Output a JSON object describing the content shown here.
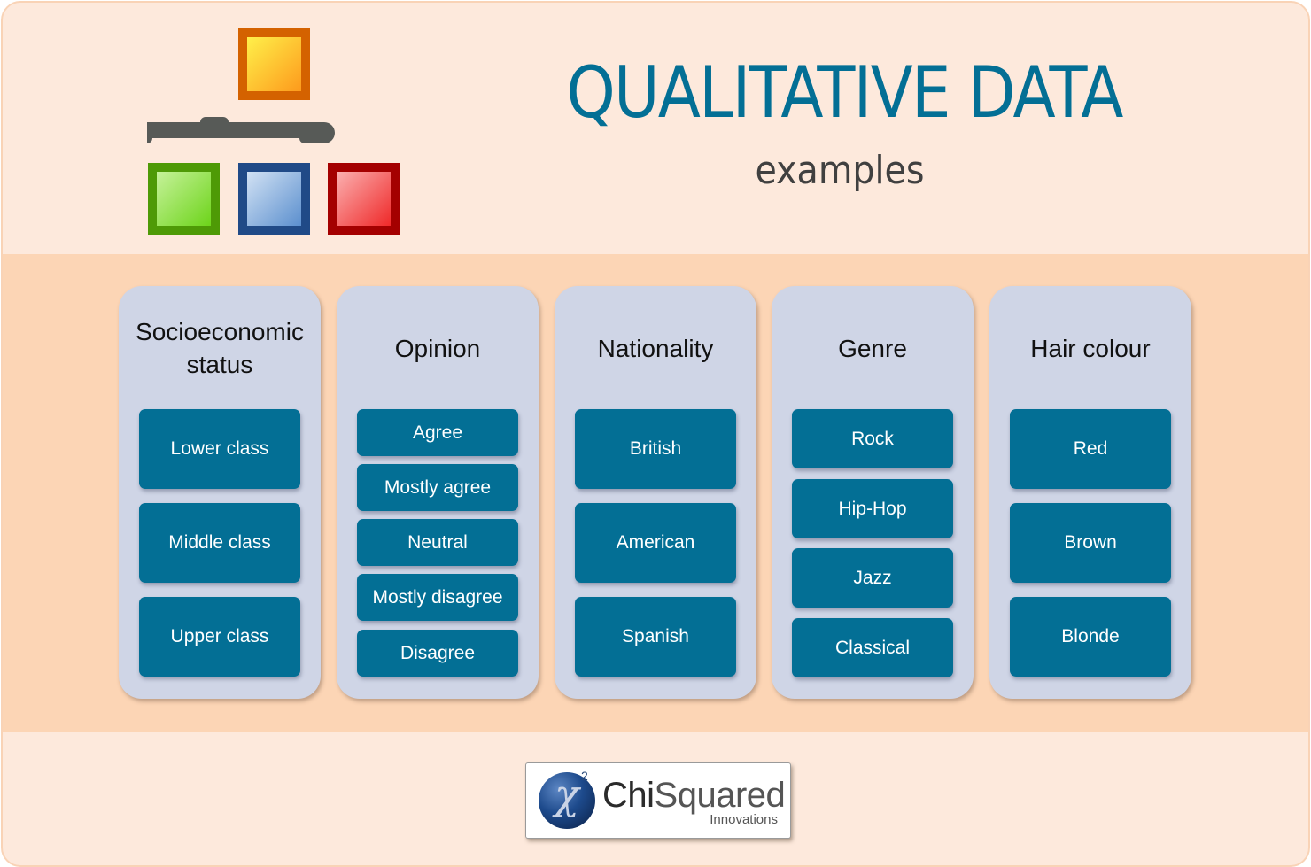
{
  "header": {
    "title": "QUALITATIVE DATA",
    "subtitle": "examples",
    "icon": "hierarchy-diagram-icon"
  },
  "colors": {
    "title": "#036f95",
    "item_fill": "#036f95",
    "column_fill": "#cfd5e6",
    "band": "#fcd5b5",
    "background": "#fde9dc",
    "icon_top": "#d46200",
    "icon_left": "#4e9a06",
    "icon_middle": "#204a87",
    "icon_right": "#a40000"
  },
  "columns": [
    {
      "heading": "Socioeconomic status",
      "heading_lines": [
        "Socioeconomic",
        "status"
      ],
      "items": [
        "Lower class",
        "Middle class",
        "Upper class"
      ]
    },
    {
      "heading": "Opinion",
      "heading_lines": [
        "Opinion"
      ],
      "items": [
        "Agree",
        "Mostly agree",
        "Neutral",
        "Mostly disagree",
        "Disagree"
      ]
    },
    {
      "heading": "Nationality",
      "heading_lines": [
        "Nationality"
      ],
      "items": [
        "British",
        "American",
        "Spanish"
      ]
    },
    {
      "heading": "Genre",
      "heading_lines": [
        "Genre"
      ],
      "items": [
        "Rock",
        "Hip-Hop",
        "Jazz",
        "Classical"
      ]
    },
    {
      "heading": "Hair colour",
      "heading_lines": [
        "Hair colour"
      ],
      "items": [
        "Red",
        "Brown",
        "Blonde"
      ]
    }
  ],
  "logo": {
    "symbol": "χ",
    "superscript": "2",
    "name_part1": "Chi",
    "name_part2": "Squared",
    "tagline": "Innovations"
  }
}
